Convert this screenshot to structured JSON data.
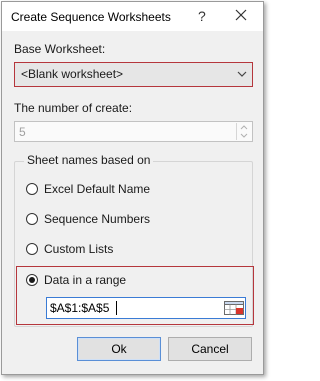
{
  "window": {
    "title": "Create Sequence Worksheets",
    "help_label": "?"
  },
  "base_worksheet": {
    "label": "Base Worksheet:",
    "selected": "<Blank worksheet>"
  },
  "number_of_create": {
    "label": "The number of create:",
    "value": "5"
  },
  "sheet_names": {
    "legend": "Sheet names based on",
    "options": [
      {
        "label": "Excel Default Name",
        "selected": false
      },
      {
        "label": "Sequence Numbers",
        "selected": false
      },
      {
        "label": "Custom Lists",
        "selected": false
      },
      {
        "label": "Data in a range",
        "selected": true
      }
    ],
    "range_value": "$A$1:$A$5"
  },
  "buttons": {
    "ok": "Ok",
    "cancel": "Cancel"
  },
  "colors": {
    "highlight": "#b5363c",
    "focus_border": "#3a7bd5"
  }
}
